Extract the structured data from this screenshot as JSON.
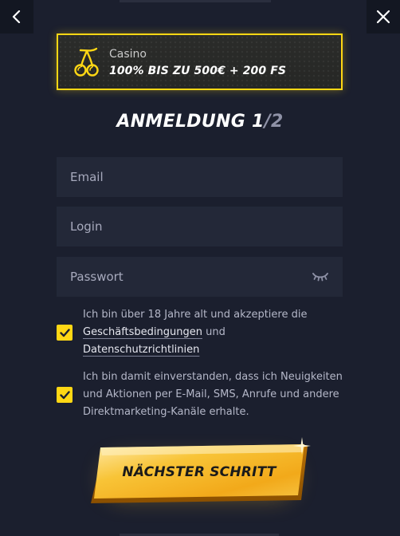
{
  "promo": {
    "category": "Casino",
    "bonus": "100% BIS ZU 500€ + 200 FS",
    "icon": "cherries-icon"
  },
  "form": {
    "title_main": "ANMELDUNG 1",
    "title_sep": "/",
    "title_total": "2",
    "email_placeholder": "Email",
    "login_placeholder": "Login",
    "password_placeholder": "Passwort"
  },
  "terms": {
    "text_before": "Ich bin über 18 Jahre alt und akzeptiere die ",
    "link_terms": "Geschäftsbedingungen",
    "text_and": " und ",
    "link_privacy": "Datenschutzrichtlinien",
    "checked": true
  },
  "marketing": {
    "text": "Ich bin damit einverstanden, dass ich Neuigkeiten und Aktionen per E-Mail, SMS, Anrufe und andere Direktmarketing-Kanäle erhalte.",
    "checked": true
  },
  "next_button": {
    "label": "NÄCHSTER SCHRITT"
  },
  "colors": {
    "background": "#1b1f2e",
    "field": "#232838",
    "accent": "#ffd714",
    "button_gold": "#f7b81f"
  }
}
